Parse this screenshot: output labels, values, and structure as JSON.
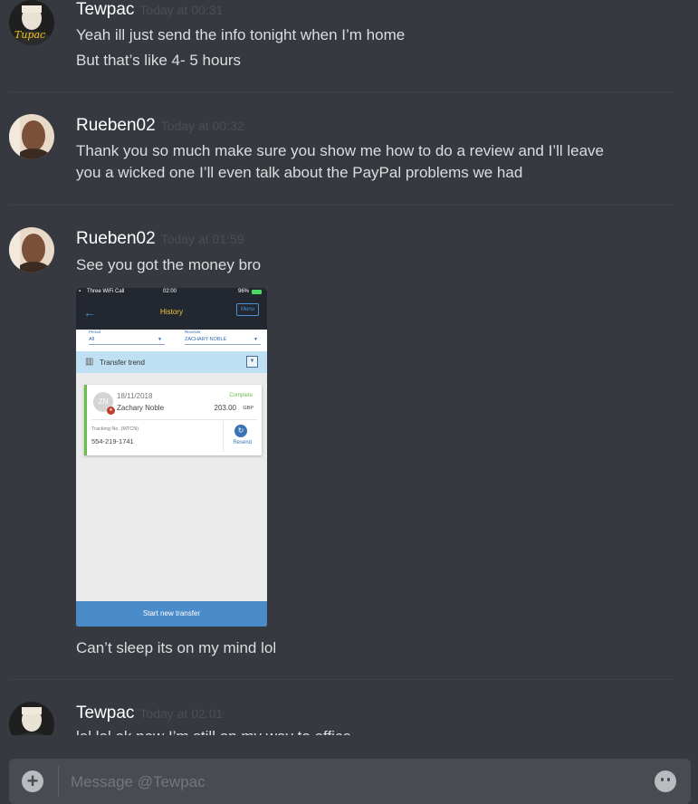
{
  "messages": [
    {
      "author": "Tewpac",
      "timestamp": "Today at 00:31",
      "lines": [
        "Yeah ill just send the info tonight when I’m home",
        "But that’s like 4- 5 hours"
      ]
    },
    {
      "author": "Rueben02",
      "timestamp": "Today at 00:32",
      "lines": [
        "Thank you so much make sure you show me how to do a review and I’ll leave",
        "you a wicked one I’ll even talk about the PayPal problems we had"
      ]
    },
    {
      "author": "Rueben02",
      "timestamp": "Today at 01:59",
      "lines": [
        "See you got the money bro",
        "Can’t sleep its on my mind lol"
      ]
    },
    {
      "author": "Tewpac",
      "timestamp": "Today at 02:01",
      "lines": [
        "lol lol ok now I’m still on my way to office"
      ]
    }
  ],
  "attachment": {
    "status_bar": {
      "carrier": "Three WiFi Call",
      "time": "02:00",
      "battery": "96%"
    },
    "title": "History",
    "menu_label": "Menu",
    "period_label": "Period",
    "period_value": "All",
    "receiver_label": "Receiver",
    "receiver_value": "ZACHARY NOBLE",
    "trend_label": "Transfer trend",
    "transaction": {
      "initials": "ZN",
      "date": "18/11/2018",
      "status": "Complete",
      "name": "Zachary Noble",
      "amount": "203.00",
      "currency": "GBP",
      "tracking_label": "Tracking No. (MTCN)",
      "tracking_number": "554-219-1741",
      "resend_label": "Resend"
    },
    "start_button": "Start new transfer"
  },
  "composer": {
    "placeholder": "Message @Tewpac"
  },
  "colors": {
    "background": "#36393f",
    "username": "#ffffff",
    "timestamp": "#4b4e55",
    "text": "#dcddde"
  }
}
